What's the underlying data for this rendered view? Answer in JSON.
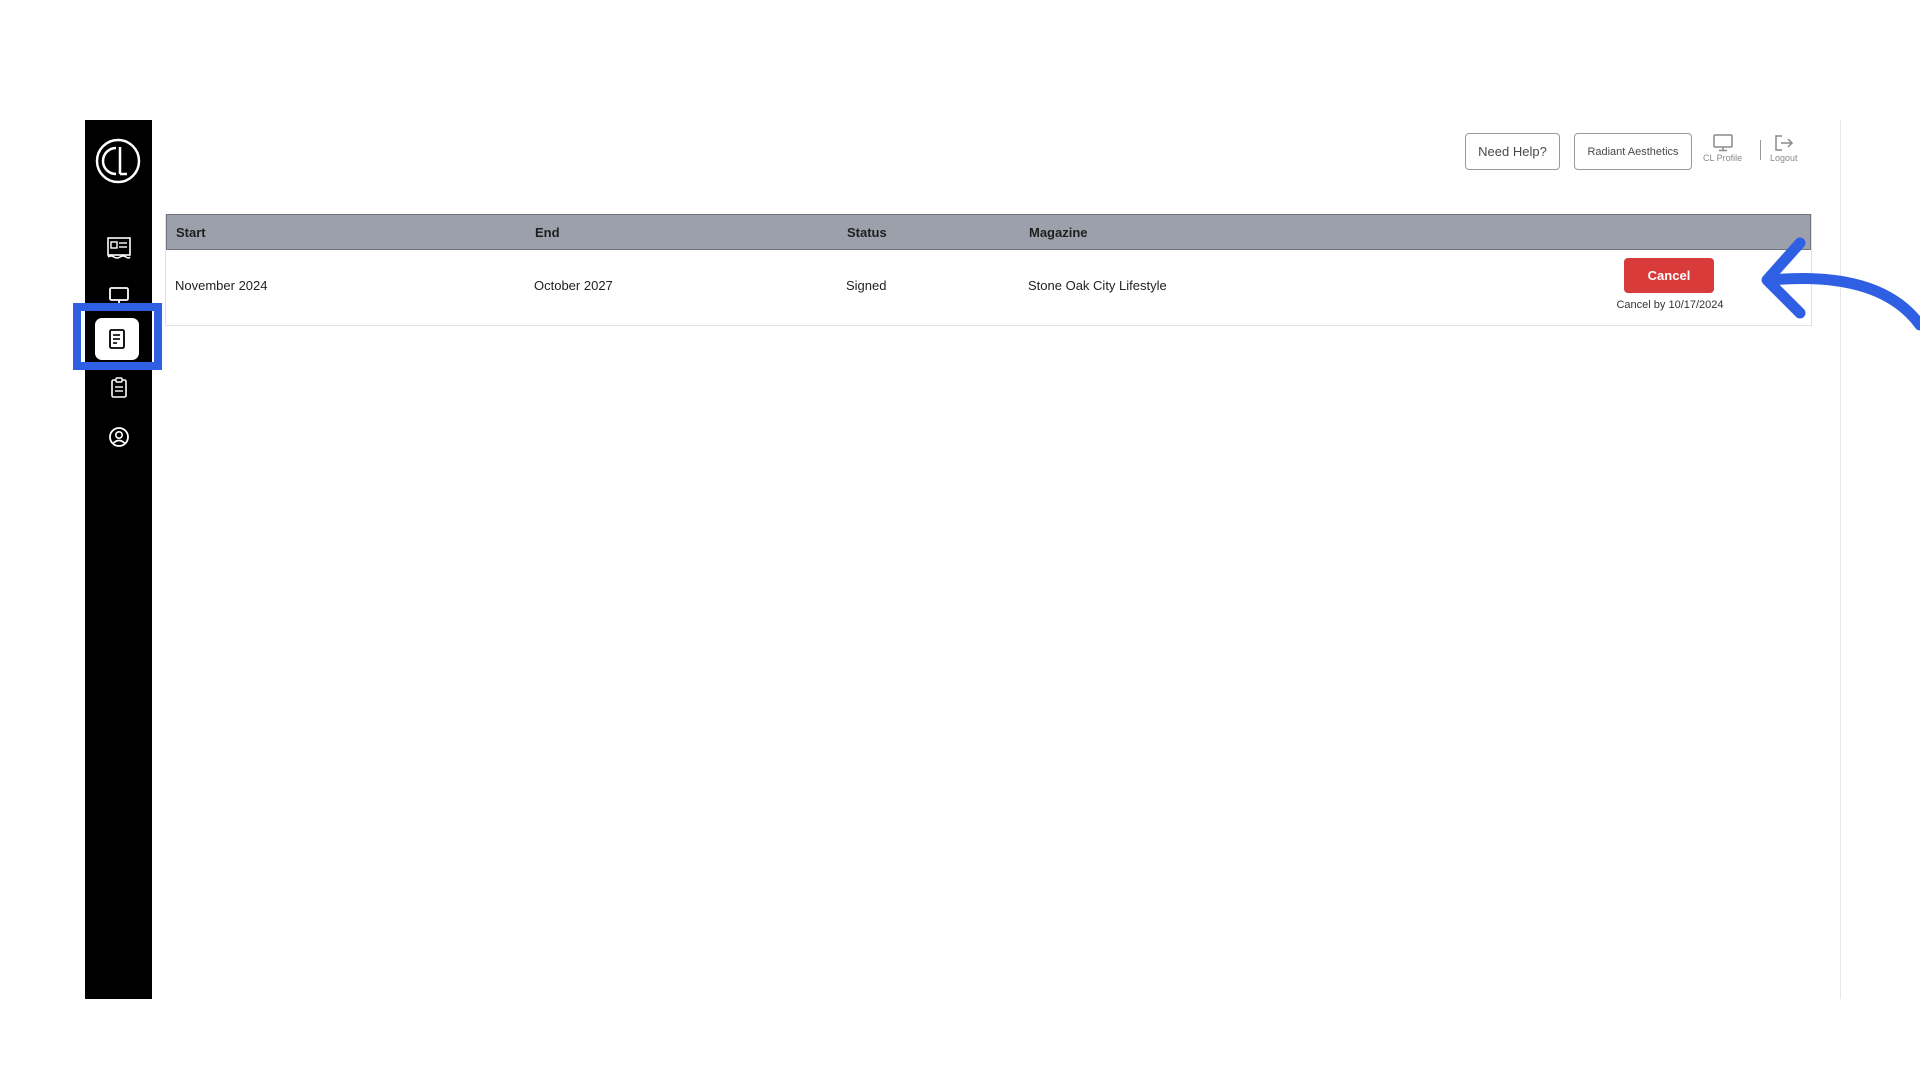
{
  "app": {
    "logo_icon": "brand-logo-icon"
  },
  "sidebar": {
    "items": [
      {
        "name": "newspaper-icon",
        "active": false
      },
      {
        "name": "monitor-icon",
        "active": false
      },
      {
        "name": "document-icon",
        "active": true
      },
      {
        "name": "clipboard-icon",
        "active": false
      },
      {
        "name": "user-circle-icon",
        "active": false
      }
    ]
  },
  "header": {
    "help_label": "Need Help?",
    "account_label": "Radiant Aesthetics",
    "profile_label": "CL Profile",
    "logout_label": "Logout"
  },
  "table": {
    "columns": [
      "Start",
      "End",
      "Status",
      "Magazine"
    ],
    "rows": [
      {
        "start": "November 2024",
        "end": "October 2027",
        "status": "Signed",
        "magazine": "Stone Oak City Lifestyle",
        "action_label": "Cancel",
        "action_note": "Cancel by 10/17/2024"
      }
    ]
  },
  "colors": {
    "sidebar_bg": "#000000",
    "header_row_bg": "#9ca0aa",
    "cancel_button": "#d93a3a",
    "highlight": "#2f5fe3"
  }
}
